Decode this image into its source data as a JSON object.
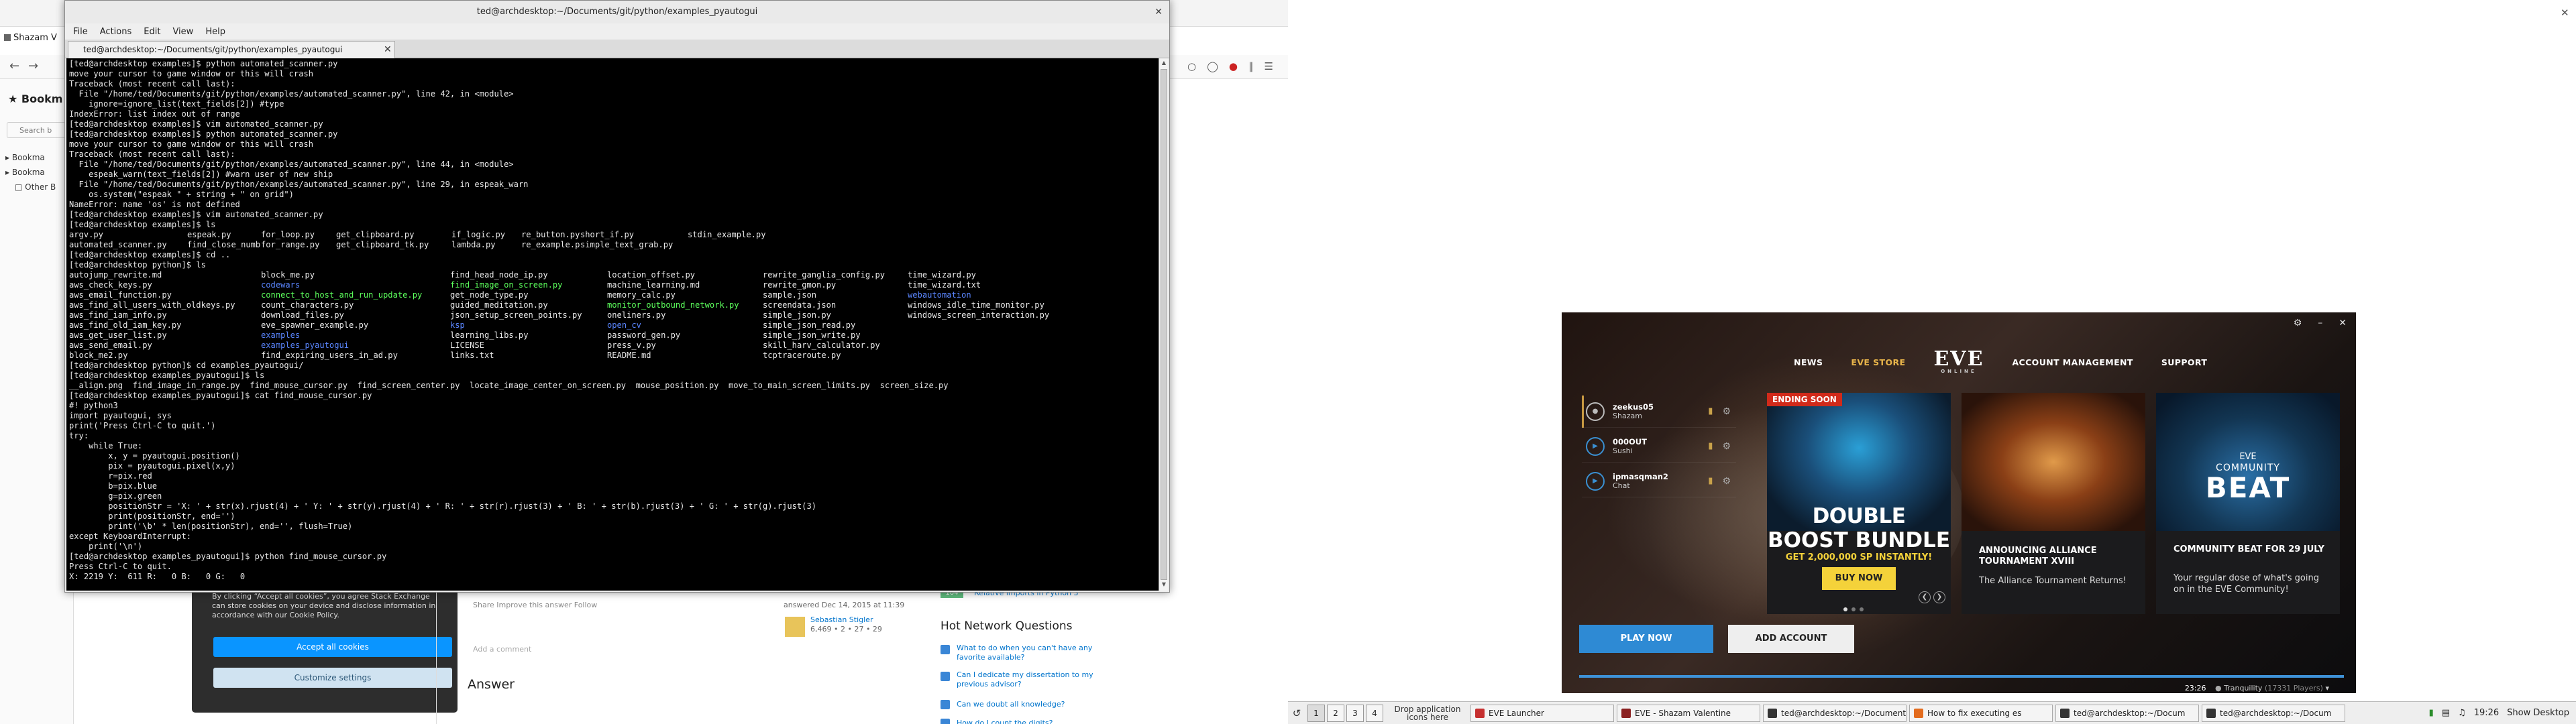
{
  "browser": {
    "tab_title": "Shazam V",
    "sidebar_title": "Bookm",
    "sidebar_search_placeholder": "Search b",
    "bookmarks": [
      "Bookma",
      "Bookma",
      "Other B"
    ]
  },
  "stackoverflow": {
    "cookie_text": "By clicking “Accept all cookies”, you agree Stack Exchange can store cookies on your device and disclose information in accordance with our Cookie Policy.",
    "accept_label": "Accept all cookies",
    "customize_label": "Customize settings",
    "share_line": "Share   Improve this answer   Follow",
    "add_comment": "Add a comment",
    "answer_heading": "Answer",
    "answered_line": "answered Dec 14, 2015 at 11:39",
    "answered_name": "Sebastian Stigler",
    "answered_rep": "6,469 • 2 • 27 • 29",
    "related_badge": "104",
    "related_text": "Relative imports in Python 3",
    "hnq_title": "Hot Network Questions",
    "hnq_items": [
      "What to do when you can't have any favorite available?",
      "Can I dedicate my dissertation to my previous advisor?",
      "Can we doubt all knowledge?",
      "How do I count the digits?"
    ]
  },
  "terminal": {
    "title": "ted@archdesktop:~/Documents/git/python/examples_pyautogui",
    "menus": [
      "File",
      "Actions",
      "Edit",
      "View",
      "Help"
    ],
    "tab_label": "ted@archdesktop:~/Documents/git/python/examples_pyautogui",
    "lines_a": [
      "[ted@archdesktop examples]$ python automated_scanner.py",
      "move your cursor to game window or this will crash",
      "Traceback (most recent call last):",
      "  File \"/home/ted/Documents/git/python/examples/automated_scanner.py\", line 42, in <module>",
      "    ignore=ignore_list(text_fields[2]) #type",
      "IndexError: list index out of range",
      "[ted@archdesktop examples]$ vim automated_scanner.py",
      "[ted@archdesktop examples]$ python automated_scanner.py",
      "move your cursor to game window or this will crash",
      "Traceback (most recent call last):",
      "  File \"/home/ted/Documents/git/python/examples/automated_scanner.py\", line 44, in <module>",
      "    espeak_warn(text_fields[2]) #warn user of new ship",
      "  File \"/home/ted/Documents/git/python/examples/automated_scanner.py\", line 29, in espeak_warn",
      "    os.system(\"espeak \" + string + \" on grid\")",
      "NameError: name 'os' is not defined",
      "[ted@archdesktop examples]$ vim automated_scanner.py",
      "[ted@archdesktop examples]$ ls"
    ],
    "ls1": [
      [
        "argv.py",
        "espeak.py",
        "for_loop.py",
        "get_clipboard.py",
        "if_logic.py",
        "re_button.py",
        "short_if.py",
        "stdin_example.py"
      ],
      [
        "automated_scanner.py",
        "find_close_number.py",
        "for_range.py",
        "get_clipboard_tk.py",
        "lambda.py",
        "re_example.py",
        "simple_text_grab.py",
        ""
      ]
    ],
    "lines_b": [
      "[ted@archdesktop examples]$ cd ..",
      "[ted@archdesktop python]$ ls"
    ],
    "ls2": [
      [
        [
          "autojump_rewrite.md",
          ""
        ],
        [
          "block_me.py",
          ""
        ],
        [
          "find_head_node_ip.py",
          ""
        ],
        [
          "location_offset.py",
          ""
        ],
        [
          "rewrite_ganglia_config.py",
          ""
        ],
        [
          "time_wizard.py",
          ""
        ]
      ],
      [
        [
          "aws_check_keys.py",
          ""
        ],
        [
          "codewars",
          "b"
        ],
        [
          "find_image_on_screen.py",
          "g"
        ],
        [
          "machine_learning.md",
          ""
        ],
        [
          "rewrite_gmon.py",
          ""
        ],
        [
          "time_wizard.txt",
          ""
        ]
      ],
      [
        [
          "aws_email_function.py",
          ""
        ],
        [
          "connect_to_host_and_run_update.py",
          "g"
        ],
        [
          "get_node_type.py",
          ""
        ],
        [
          "memory_calc.py",
          ""
        ],
        [
          "sample.json",
          ""
        ],
        [
          "webautomation",
          "b"
        ]
      ],
      [
        [
          "aws_find_all_users_with_oldkeys.py",
          ""
        ],
        [
          "count_characters.py",
          ""
        ],
        [
          "guided_meditation.py",
          ""
        ],
        [
          "monitor_outbound_network.py",
          "g"
        ],
        [
          "screendata.json",
          ""
        ],
        [
          "windows_idle_time_monitor.py",
          ""
        ]
      ],
      [
        [
          "aws_find_iam_info.py",
          ""
        ],
        [
          "download_files.py",
          ""
        ],
        [
          "json_setup_screen_points.py",
          ""
        ],
        [
          "oneliners.py",
          ""
        ],
        [
          "simple_json.py",
          ""
        ],
        [
          "windows_screen_interaction.py",
          ""
        ]
      ],
      [
        [
          "aws_find_old_iam_key.py",
          ""
        ],
        [
          "eve_spawner_example.py",
          ""
        ],
        [
          "ksp",
          "b"
        ],
        [
          "open_cv",
          "b"
        ],
        [
          "simple_json_read.py",
          ""
        ],
        [
          "",
          ""
        ]
      ],
      [
        [
          "aws_get_user_list.py",
          ""
        ],
        [
          "examples",
          "b"
        ],
        [
          "learning_libs.py",
          ""
        ],
        [
          "password_gen.py",
          ""
        ],
        [
          "simple_json_write.py",
          ""
        ],
        [
          "",
          ""
        ]
      ],
      [
        [
          "aws_send_email.py",
          ""
        ],
        [
          "examples_pyautogui",
          "b"
        ],
        [
          "LICENSE",
          ""
        ],
        [
          "press_v.py",
          ""
        ],
        [
          "skill_harv_calculator.py",
          ""
        ],
        [
          "",
          ""
        ]
      ],
      [
        [
          "block_me2.py",
          ""
        ],
        [
          "find_expiring_users_in_ad.py",
          ""
        ],
        [
          "links.txt",
          ""
        ],
        [
          "README.md",
          ""
        ],
        [
          "tcptraceroute.py",
          ""
        ],
        [
          "",
          ""
        ]
      ]
    ],
    "lines_c": [
      "[ted@archdesktop python]$ cd examples_pyautogui/",
      "[ted@archdesktop examples_pyautogui]$ ls",
      "__align.png  find_image_in_range.py  find_mouse_cursor.py  find_screen_center.py  locate_image_center_on_screen.py  mouse_position.py  move_to_main_screen_limits.py  screen_size.py",
      "[ted@archdesktop examples_pyautogui]$ cat find_mouse_cursor.py",
      "#! python3",
      "import pyautogui, sys",
      "print('Press Ctrl-C to quit.')",
      "try:",
      "    while True:",
      "        x, y = pyautogui.position()",
      "        pix = pyautogui.pixel(x,y)",
      "        r=pix.red",
      "        b=pix.blue",
      "        g=pix.green",
      "        positionStr = 'X: ' + str(x).rjust(4) + ' Y: ' + str(y).rjust(4) + ' R: ' + str(r).rjust(3) + ' B: ' + str(b).rjust(3) + ' G: ' + str(g).rjust(3)",
      "        print(positionStr, end='')",
      "        print('\\b' * len(positionStr), end='', flush=True)",
      "except KeyboardInterrupt:",
      "    print('\\n')",
      "[ted@archdesktop examples_pyautogui]$ python find_mouse_cursor.py",
      "Press Ctrl-C to quit.",
      "X: 2219 Y:  611 R:   0 B:   0 G:   0"
    ]
  },
  "eve": {
    "nav": [
      "NEWS",
      "EVE STORE",
      "ACCOUNT MANAGEMENT",
      "SUPPORT"
    ],
    "logo": "EVE",
    "logo_sub": "ONLINE",
    "accounts": [
      {
        "name": "zeekus05",
        "char": "Shazam"
      },
      {
        "name": "000OUT",
        "char": "Sushi"
      },
      {
        "name": "ipmasqman2",
        "char": "Chat"
      }
    ],
    "card1": {
      "badge": "ENDING SOON",
      "line1": "DOUBLE",
      "line2": "BOOST BUNDLE",
      "sp": "GET 2,000,000 SP INSTANTLY!",
      "button": "BUY NOW"
    },
    "card2": {
      "title": "ANNOUNCING ALLIANCE TOURNAMENT XVIII",
      "body": "The Alliance Tournament Returns!"
    },
    "card3": {
      "small": "EVE",
      "community": "COMMUNITY",
      "beat": "BEAT",
      "title": "COMMUNITY BEAT FOR 29 JULY",
      "body": "Your regular dose of what's going on in the EVE Community!"
    },
    "play_label": "PLAY NOW",
    "add_account_label": "ADD ACCOUNT",
    "time": "23:26",
    "server": "Tranquility",
    "players": "(17331 Players)",
    "window_controls": [
      "⚙",
      "–",
      "✕"
    ]
  },
  "panel": {
    "workspaces": [
      "1",
      "2",
      "3",
      "4"
    ],
    "drop_hint": "Drop application icons here",
    "tasks": [
      {
        "label": "EVE Launcher",
        "color": "#c63030"
      },
      {
        "label": "EVE - Shazam Valentine",
        "color": "#8a2020"
      },
      {
        "label": "ted@archdesktop:~/Documents/git/pyt",
        "color": "#333333"
      },
      {
        "label": "How to fix executing es",
        "color": "#e36c1e"
      },
      {
        "label": "ted@archdesktop:~/Docum",
        "color": "#333333"
      },
      {
        "label": "ted@archdesktop:~/Docum",
        "color": "#333333"
      }
    ],
    "clock": "19:26",
    "show_desktop": "Show Desktop"
  }
}
